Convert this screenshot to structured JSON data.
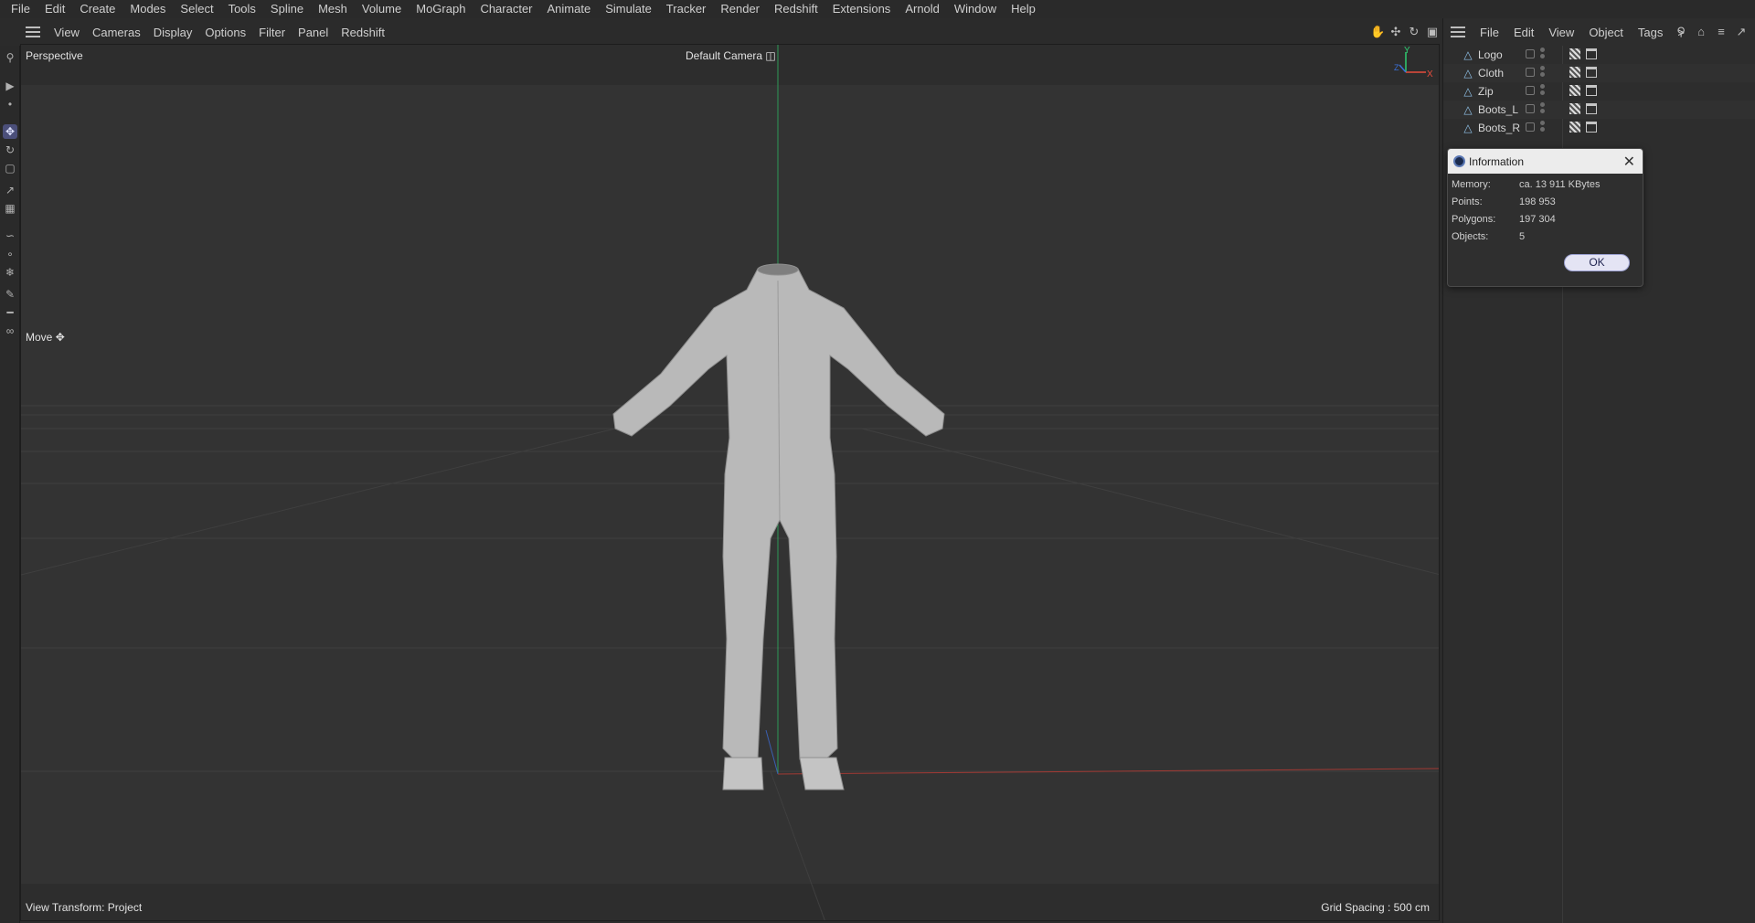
{
  "menubar": [
    "File",
    "Edit",
    "Create",
    "Modes",
    "Select",
    "Tools",
    "Spline",
    "Mesh",
    "Volume",
    "MoGraph",
    "Character",
    "Animate",
    "Simulate",
    "Tracker",
    "Render",
    "Redshift",
    "Extensions",
    "Arnold",
    "Window",
    "Help"
  ],
  "viewport_menu": [
    "View",
    "Cameras",
    "Display",
    "Options",
    "Filter",
    "Panel",
    "Redshift"
  ],
  "viewport": {
    "projection": "Perspective",
    "camera": "Default Camera",
    "active_tool": "Move",
    "view_transform": "View Transform: Project",
    "grid_spacing": "Grid Spacing : 500 cm",
    "axis_labels": {
      "y": "Y",
      "x": "X",
      "z": "Z"
    }
  },
  "object_manager": {
    "menu": [
      "File",
      "Edit",
      "View",
      "Object",
      "Tags"
    ],
    "more": ">",
    "objects": [
      {
        "name": "Logo"
      },
      {
        "name": "Cloth"
      },
      {
        "name": "Zip"
      },
      {
        "name": "Boots_L"
      },
      {
        "name": "Boots_R"
      }
    ]
  },
  "info_dialog": {
    "title": "Information",
    "rows": [
      {
        "key": "Memory:",
        "value": "ca. 13 911 KBytes"
      },
      {
        "key": "Points:",
        "value": "198 953"
      },
      {
        "key": "Polygons:",
        "value": "197 304"
      },
      {
        "key": "Objects:",
        "value": "5"
      }
    ],
    "ok_label": "OK"
  },
  "colors": {
    "accent": "#4b4f7a",
    "axis_x": "#c0392b",
    "axis_y": "#2ecc71",
    "axis_z": "#3a6fd8"
  }
}
